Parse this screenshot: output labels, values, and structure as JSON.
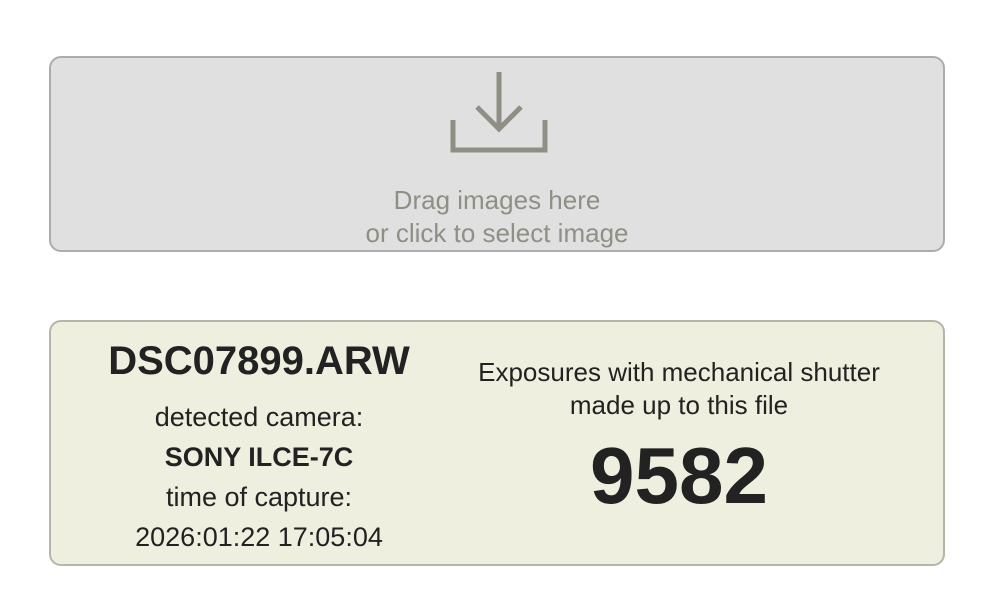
{
  "dropzone": {
    "icon": "download-icon",
    "line1": "Drag images here",
    "line2": "or click to select image"
  },
  "result": {
    "filename": "DSC07899.ARW",
    "camera_label": "detected camera:",
    "camera": "SONY ILCE-7C",
    "time_label": "time of capture:",
    "time": "2026:01:22 17:05:04",
    "description_line1": "Exposures with mechanical shutter",
    "description_line2": "made up to this file",
    "count": "9582"
  },
  "colors": {
    "dropzone_bg": "#e0e0e0",
    "dropzone_text": "#8f8f85",
    "result_bg": "#efefe0",
    "text": "#222222"
  }
}
